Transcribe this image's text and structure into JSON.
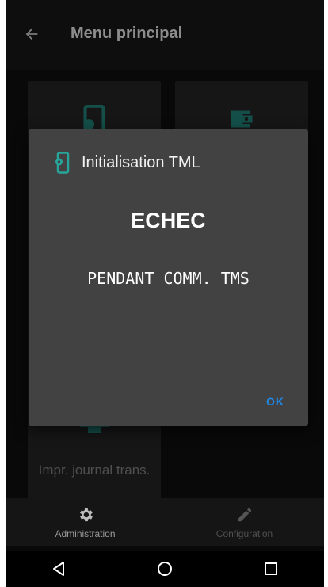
{
  "app_bar": {
    "title": "Menu principal",
    "back_icon": "arrow-back-icon"
  },
  "tiles": [
    {
      "icon": "phone-gear-icon",
      "label": "Impr. journal trans.",
      "bottom_icon": "printer-icon"
    },
    {
      "icon": "wallet-icon"
    }
  ],
  "dialog": {
    "title": "Initialisation TML",
    "title_icon": "phone-gear-icon",
    "status": "ECHEC",
    "message": "PENDANT COMM. TMS",
    "ok_label": "OK"
  },
  "bottom_nav": [
    {
      "label": "Administration",
      "icon": "gear-icon",
      "active": true
    },
    {
      "label": "Configuration",
      "icon": "pencil-icon",
      "active": false
    }
  ],
  "system_nav": [
    {
      "icon": "back-triangle-icon"
    },
    {
      "icon": "home-circle-icon"
    },
    {
      "icon": "recents-square-icon"
    }
  ],
  "colors": {
    "accent": "#26a69a",
    "ok_button": "#1e88e5",
    "dialog_bg": "#424242",
    "background": "#0f0f0f"
  }
}
